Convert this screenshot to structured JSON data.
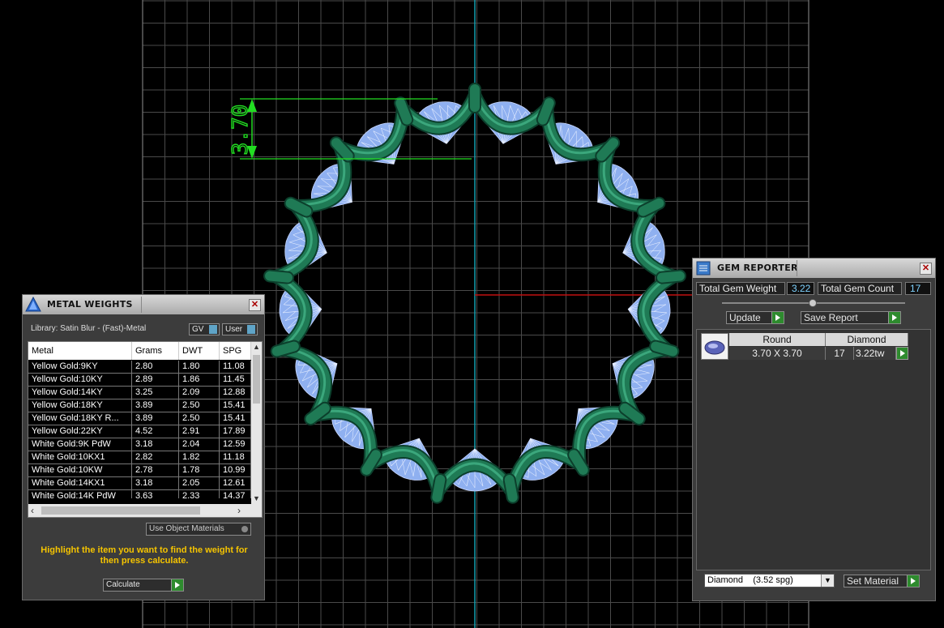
{
  "viewport": {
    "dimension_label": "3.70"
  },
  "metal_weights": {
    "title": "METAL WEIGHTS",
    "library": "Library: Satin Blur - (Fast)-Metal",
    "gv_label": "GV",
    "user_label": "User",
    "columns": [
      "Metal",
      "Grams",
      "DWT",
      "SPG"
    ],
    "rows": [
      {
        "metal": "Yellow Gold:9KY",
        "grams": "2.80",
        "dwt": "1.80",
        "spg": "11.08"
      },
      {
        "metal": "Yellow Gold:10KY",
        "grams": "2.89",
        "dwt": "1.86",
        "spg": "11.45"
      },
      {
        "metal": "Yellow Gold:14KY",
        "grams": "3.25",
        "dwt": "2.09",
        "spg": "12.88"
      },
      {
        "metal": "Yellow Gold:18KY",
        "grams": "3.89",
        "dwt": "2.50",
        "spg": "15.41"
      },
      {
        "metal": "Yellow Gold:18KY R...",
        "grams": "3.89",
        "dwt": "2.50",
        "spg": "15.41"
      },
      {
        "metal": "Yellow Gold:22KY",
        "grams": "4.52",
        "dwt": "2.91",
        "spg": "17.89"
      },
      {
        "metal": "White Gold:9K PdW",
        "grams": "3.18",
        "dwt": "2.04",
        "spg": "12.59"
      },
      {
        "metal": "White Gold:10KX1",
        "grams": "2.82",
        "dwt": "1.82",
        "spg": "11.18"
      },
      {
        "metal": "White Gold:10KW",
        "grams": "2.78",
        "dwt": "1.78",
        "spg": "10.99"
      },
      {
        "metal": "White Gold:14KX1",
        "grams": "3.18",
        "dwt": "2.05",
        "spg": "12.61"
      },
      {
        "metal": "White Gold:14K PdW",
        "grams": "3.63",
        "dwt": "2.33",
        "spg": "14.37"
      }
    ],
    "use_object_materials": "Use Object Materials",
    "hint": "Highlight the item you want to find the weight for then press calculate.",
    "calculate_label": "Calculate"
  },
  "gem_reporter": {
    "title": "GEM REPORTER",
    "total_weight_label": "Total Gem Weight",
    "total_weight_value": "3.22",
    "total_count_label": "Total Gem Count",
    "total_count_value": "17",
    "update_label": "Update",
    "save_report_label": "Save Report",
    "gem_row": {
      "shape": "Round",
      "material": "Diamond",
      "size": "3.70 X 3.70",
      "count": "17",
      "weight": "3.22tw"
    },
    "material_select": "Diamond    (3.52 spg)",
    "set_material_label": "Set Material"
  },
  "colors": {
    "grid": "#4a4a4a",
    "gem": "#8fb0f0",
    "metal": "#1f7a55",
    "dimension": "#22dd22",
    "axis_y": "#16a0b0",
    "axis_x": "#c01010",
    "hint_text": "#f5c400"
  }
}
